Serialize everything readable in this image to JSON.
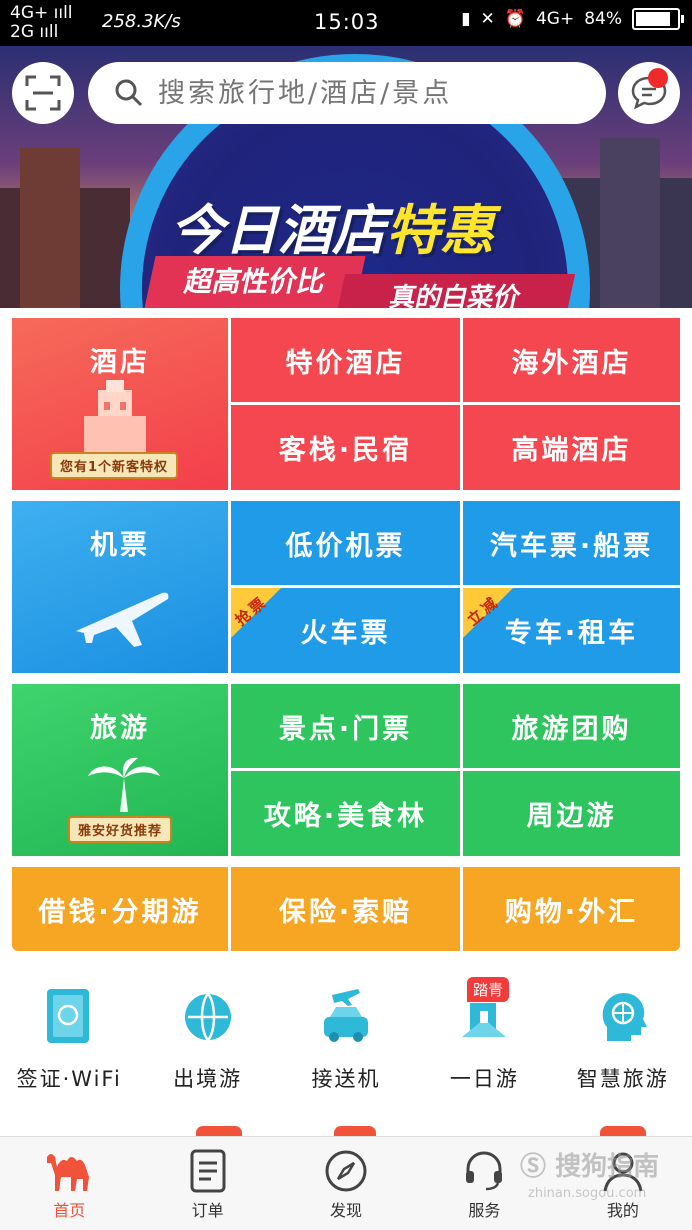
{
  "status_bar": {
    "network1": "4G+",
    "network2": "2G",
    "speed": "258.3K/s",
    "time": "15:03",
    "network3": "4G+",
    "battery": "84%"
  },
  "header": {
    "search_placeholder": "搜索旅行地/酒店/景点"
  },
  "banner": {
    "title_main": "今日酒店",
    "title_highlight": "特惠",
    "ribbon_left": "超高性价比",
    "ribbon_right": "真的白菜价",
    "slide_count": 7,
    "active_slide": 1
  },
  "grid": {
    "hotel": {
      "main": "酒店",
      "badge": "您有1个新客特权",
      "items": [
        "特价酒店",
        "海外酒店",
        "客栈·民宿",
        "高端酒店"
      ]
    },
    "flight": {
      "main": "机票",
      "items": [
        "低价机票",
        "汽车票·船票",
        "火车票",
        "专车·租车"
      ],
      "tag_train": "抢票",
      "tag_car": "立减"
    },
    "travel": {
      "main": "旅游",
      "badge": "雅安好货推荐",
      "items": [
        "景点·门票",
        "旅游团购",
        "攻略·美食林",
        "周边游"
      ]
    },
    "finance": {
      "items": [
        "借钱·分期游",
        "保险·索赔",
        "购物·外汇"
      ]
    }
  },
  "quick_icons": [
    {
      "label": "签证·WiFi",
      "icon": "passport-icon"
    },
    {
      "label": "出境游",
      "icon": "globe-icon"
    },
    {
      "label": "接送机",
      "icon": "car-plane-icon"
    },
    {
      "label": "一日游",
      "icon": "day-trip-icon",
      "badge": "踏青"
    },
    {
      "label": "智慧旅游",
      "icon": "smart-head-icon"
    }
  ],
  "tabbar": {
    "items": [
      {
        "label": "首页",
        "icon": "camel-icon"
      },
      {
        "label": "订单",
        "icon": "order-icon"
      },
      {
        "label": "发现",
        "icon": "compass-icon"
      },
      {
        "label": "服务",
        "icon": "headset-icon"
      },
      {
        "label": "我的",
        "icon": "user-icon"
      }
    ]
  },
  "colors": {
    "hotel_red": "#f4474f",
    "flight_blue": "#1f9be8",
    "travel_green": "#2ec55e",
    "finance_orange": "#f6a623",
    "accent": "#f0533a"
  },
  "watermark": {
    "text": "搜狗指南",
    "url": "zhinan.sogou.com"
  }
}
